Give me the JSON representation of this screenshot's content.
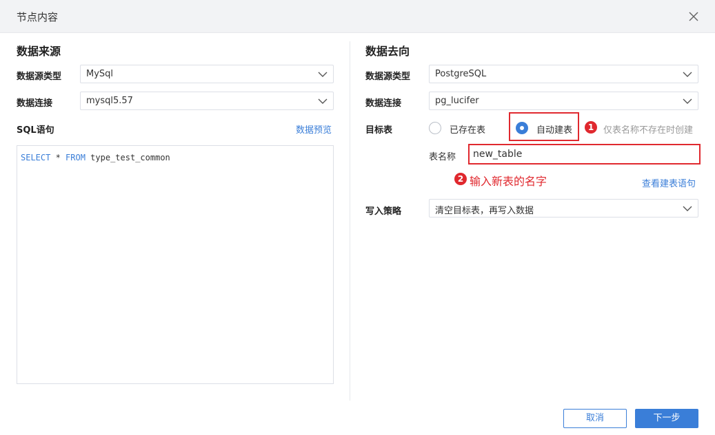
{
  "dialog": {
    "title": "节点内容"
  },
  "source": {
    "title": "数据来源",
    "type_label": "数据源类型",
    "type_value": "MySql",
    "conn_label": "数据连接",
    "conn_value": "mysql5.57",
    "sql_label": "SQL语句",
    "preview_link": "数据预览",
    "sql": {
      "kw1": "SELECT",
      "mid": " * ",
      "kw2": "FROM",
      "rest": " type_test_common"
    }
  },
  "target": {
    "title": "数据去向",
    "type_label": "数据源类型",
    "type_value": "PostgreSQL",
    "conn_label": "数据连接",
    "conn_value": "pg_lucifer",
    "table_label": "目标表",
    "radio_existing": "已存在表",
    "radio_auto": "自动建表",
    "badge1": "1",
    "auto_hint": "仅表名称不存在时创建",
    "name_label": "表名称",
    "name_value": "new_table",
    "badge2": "2",
    "name_annotation": "输入新表的名字",
    "view_sql_link": "查看建表语句",
    "strategy_label": "写入策略",
    "strategy_value": "清空目标表，再写入数据"
  },
  "footer": {
    "cancel": "取消",
    "next": "下一步"
  },
  "colors": {
    "accent": "#3a7ed8",
    "annotation_red": "#e0282e"
  }
}
